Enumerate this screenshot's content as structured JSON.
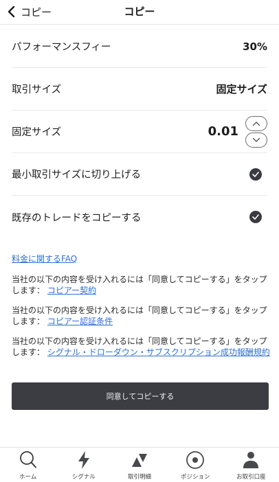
{
  "header": {
    "back_label": "コピー",
    "title": "コピー"
  },
  "settings": {
    "fee": {
      "label": "パフォーマンスフィー",
      "value": "30%"
    },
    "size_type": {
      "label": "取引サイズ",
      "value": "固定サイズ"
    },
    "fixed_size": {
      "label": "固定サイズ",
      "value": "0.01"
    },
    "round_up": {
      "label": "最小取引サイズに切り上げる",
      "checked": true
    },
    "copy_existing": {
      "label": "既存のトレードをコピーする",
      "checked": true
    }
  },
  "faq_link": "料金に関するFAQ",
  "terms": [
    {
      "text": "当社の以下の内容を受け入れるには「同意してコピーする」をタップします：",
      "link": "コピアー契約"
    },
    {
      "text": "当社の以下の内容を受け入れるには「同意してコピーする」をタップします：",
      "link": "コピアー認証条件"
    },
    {
      "text": "当社の以下の内容を受け入れるには「同意してコピーする」をタップします：",
      "link": "シグナル・ドローダウン・サブスクリプション成功報酬規約"
    }
  ],
  "agree_button": "同意してコピーする",
  "tabs": [
    {
      "label": "ホーム",
      "icon": "search-icon"
    },
    {
      "label": "シグナル",
      "icon": "lightning-icon"
    },
    {
      "label": "取引明細",
      "icon": "up-down-triangles-icon"
    },
    {
      "label": "ポジション",
      "icon": "target-circle-icon"
    },
    {
      "label": "お取引口座",
      "icon": "person-icon"
    }
  ],
  "colors": {
    "accent_dark": "#3b3d42",
    "link": "#2f6fd6"
  }
}
